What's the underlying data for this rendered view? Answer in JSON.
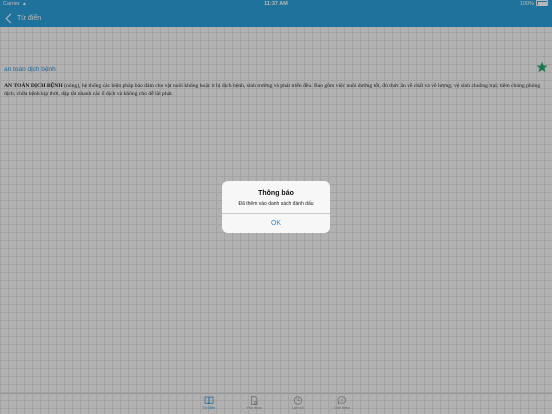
{
  "status_bar": {
    "carrier": "Carrier",
    "time": "11:37 AM",
    "battery": "100%"
  },
  "nav": {
    "back_label": "Từ điển"
  },
  "entry": {
    "term": "an toàn dịch bệnh",
    "bookmarked": true,
    "headword": "AN TOÀN DỊCH BỆNH",
    "definition": "(nông), hệ thống các biện pháp bảo đảm cho vật nuôi không hoặc ít bị dịch bệnh, sinh trưởng và phát triển đều. Bao gồm việc nuôi dưỡng tốt, đủ thức ăn về chất và về lượng; vệ sinh chuồng trại; tiêm chủng phòng dịch; chữa bệnh kịp thời, dập tắt nhanh các ổ dịch và không cho dễ lài phát."
  },
  "alert": {
    "title": "Thông báo",
    "message": "Đã thêm vào danh sách đánh dấu",
    "ok_label": "OK"
  },
  "tabs": [
    {
      "label": "Từ điển",
      "icon": "book-icon",
      "active": true
    },
    {
      "label": "Yêu thích",
      "icon": "bookmark-doc-icon",
      "active": false
    },
    {
      "label": "Lịch sử",
      "icon": "clock-icon",
      "active": false
    },
    {
      "label": "Giới thiệu",
      "icon": "info-bubble-icon",
      "active": false
    }
  ],
  "colors": {
    "accent": "#2a9fd8",
    "link": "#2a8fd0",
    "star": "#23a86b"
  }
}
